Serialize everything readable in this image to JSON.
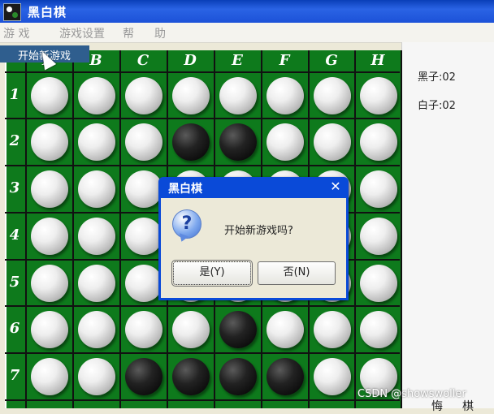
{
  "window": {
    "title": "黑白棋"
  },
  "menu": {
    "items": [
      "游 戏",
      "游戏设置",
      "帮",
      "助"
    ],
    "dropdown_item": "开始新游戏"
  },
  "board": {
    "columns": [
      "A",
      "B",
      "C",
      "D",
      "E",
      "F",
      "G",
      "H"
    ],
    "rows": [
      "1",
      "2",
      "3",
      "4",
      "5",
      "6",
      "7"
    ],
    "cells": [
      [
        "white",
        "white",
        "white",
        "white",
        "white",
        "white",
        "white",
        "white"
      ],
      [
        "white",
        "white",
        "white",
        "black",
        "black",
        "white",
        "white",
        "white"
      ],
      [
        "white",
        "white",
        "white",
        "white",
        "white",
        "white",
        "white",
        "white"
      ],
      [
        "white",
        "white",
        "white",
        "white",
        "white",
        "white",
        "white",
        "white"
      ],
      [
        "white",
        "white",
        "white",
        "white",
        "white",
        "white",
        "white",
        "white"
      ],
      [
        "white",
        "white",
        "white",
        "white",
        "black",
        "white",
        "white",
        "white"
      ],
      [
        "white",
        "white",
        "black",
        "black",
        "black",
        "black",
        "white",
        "white"
      ]
    ]
  },
  "score": {
    "black_label": "黑子:02",
    "white_label": "白子:02"
  },
  "side_buttons": [
    "悔",
    "棋"
  ],
  "dialog": {
    "title": "黑白棋",
    "close": "✕",
    "icon": "?",
    "message": "开始新游戏吗?",
    "yes": "是(Y)",
    "no": "否(N)"
  },
  "watermark": "CSDN @showswoller"
}
